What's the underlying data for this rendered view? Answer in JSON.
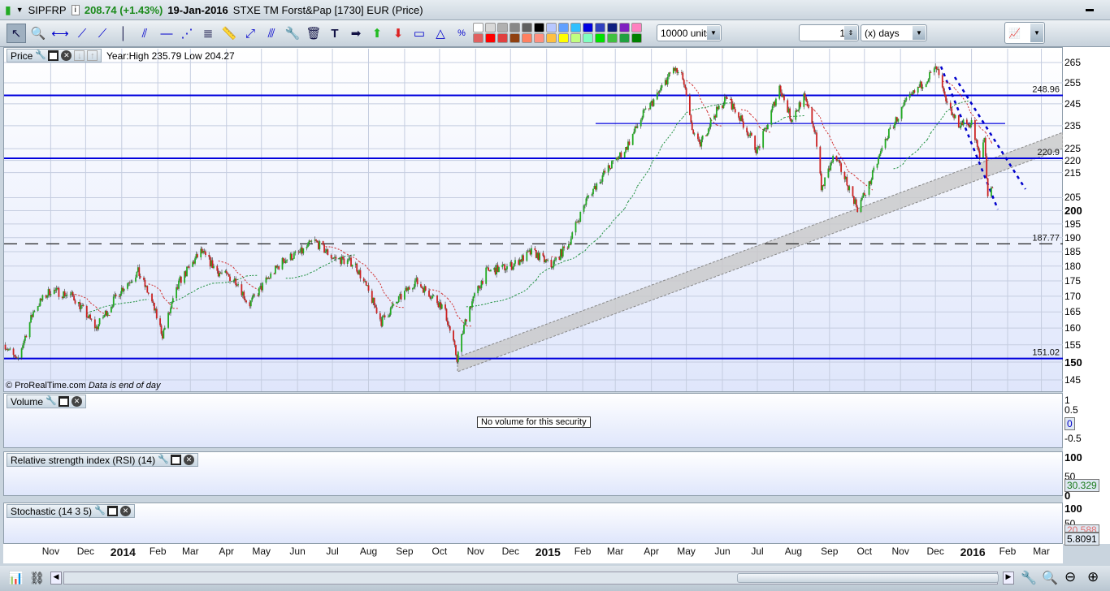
{
  "header": {
    "symbol": "SIPFRP",
    "last": "208.74 (+1.43%)",
    "date": "19-Jan-2016",
    "description": "STXE TM Forst&Pap [1730] EUR (Price)"
  },
  "toolbar": {
    "units": "10000 units",
    "period_value": "1",
    "period_unit": "(x) days",
    "colors_top": [
      "#ffffff",
      "#d8d8d8",
      "#b0b0b0",
      "#888888",
      "#606060",
      "#000000",
      "#b8c8ff",
      "#60a0ff",
      "#30c0ff",
      "#0000e0",
      "#3040c0",
      "#102080",
      "#8020c0",
      "#ff80c0"
    ],
    "colors_bottom": [
      "#e06060",
      "#ff0000",
      "#e04040",
      "#904010",
      "#ff8060",
      "#ff9080",
      "#ffc040",
      "#ffff00",
      "#c0ff80",
      "#80ffc0",
      "#00e000",
      "#40c040",
      "#20a040",
      "#008000"
    ]
  },
  "price_pane": {
    "title": "Price",
    "info": "Year:High 235.79 Low 204.27",
    "copyright": "© ProRealTime.com",
    "note": "Data is end of day",
    "current": "208.74"
  },
  "volume_pane": {
    "title": "Volume",
    "message": "No volume for this security",
    "ticks": [
      "1",
      "0.5",
      "0",
      "-0.5"
    ]
  },
  "rsi_pane": {
    "title": "Relative strength index (RSI) (14)",
    "ticks": [
      "100",
      "50",
      "0"
    ],
    "current": "30.329"
  },
  "stoch_pane": {
    "title": "Stochastic (14 3 5)",
    "ticks": [
      "100",
      "50"
    ],
    "current_d": "20.588",
    "current_k": "5.8091"
  },
  "chart_data": {
    "type": "candlestick",
    "scale": "log",
    "ylim": [
      145,
      268
    ],
    "yticks": [
      145,
      150,
      155,
      160,
      165,
      170,
      175,
      180,
      185,
      190,
      195,
      200,
      205,
      215,
      220,
      225,
      235,
      245,
      255,
      265
    ],
    "levels": [
      {
        "value": 248.96,
        "label": "248.96"
      },
      {
        "value": 220.9,
        "label": "220.9"
      },
      {
        "value": 187.77,
        "label": "187.77",
        "dashed": true
      },
      {
        "value": 151.02,
        "label": "151.02"
      },
      {
        "value": 236,
        "label": ""
      }
    ],
    "x_labels": [
      {
        "date": "2013-11-01",
        "label": "Nov"
      },
      {
        "date": "2013-12-01",
        "label": "Dec"
      },
      {
        "date": "2014-01-01",
        "label": "2014",
        "bold": true
      },
      {
        "date": "2014-02-01",
        "label": "Feb"
      },
      {
        "date": "2014-03-01",
        "label": "Mar"
      },
      {
        "date": "2014-04-01",
        "label": "Apr"
      },
      {
        "date": "2014-05-01",
        "label": "May"
      },
      {
        "date": "2014-06-01",
        "label": "Jun"
      },
      {
        "date": "2014-07-01",
        "label": "Jul"
      },
      {
        "date": "2014-08-01",
        "label": "Aug"
      },
      {
        "date": "2014-09-01",
        "label": "Sep"
      },
      {
        "date": "2014-10-01",
        "label": "Oct"
      },
      {
        "date": "2014-11-01",
        "label": "Nov"
      },
      {
        "date": "2014-12-01",
        "label": "Dec"
      },
      {
        "date": "2015-01-01",
        "label": "2015",
        "bold": true
      },
      {
        "date": "2015-02-01",
        "label": "Feb"
      },
      {
        "date": "2015-03-01",
        "label": "Mar"
      },
      {
        "date": "2015-04-01",
        "label": "Apr"
      },
      {
        "date": "2015-05-01",
        "label": "May"
      },
      {
        "date": "2015-06-01",
        "label": "Jun"
      },
      {
        "date": "2015-07-01",
        "label": "Jul"
      },
      {
        "date": "2015-08-01",
        "label": "Aug"
      },
      {
        "date": "2015-09-01",
        "label": "Sep"
      },
      {
        "date": "2015-10-01",
        "label": "Oct"
      },
      {
        "date": "2015-11-01",
        "label": "Nov"
      },
      {
        "date": "2015-12-01",
        "label": "Dec"
      },
      {
        "date": "2016-01-01",
        "label": "2016",
        "bold": true
      },
      {
        "date": "2016-02-01",
        "label": "Feb"
      },
      {
        "date": "2016-03-01",
        "label": "Mar"
      }
    ],
    "price_keypoints": [
      [
        "2013-09-23",
        155
      ],
      [
        "2013-10-03",
        150
      ],
      [
        "2013-10-18",
        166
      ],
      [
        "2013-11-01",
        172
      ],
      [
        "2013-11-20",
        170
      ],
      [
        "2013-12-10",
        160
      ],
      [
        "2013-12-31",
        172
      ],
      [
        "2014-01-15",
        178
      ],
      [
        "2014-01-25",
        170
      ],
      [
        "2014-02-05",
        158
      ],
      [
        "2014-02-20",
        175
      ],
      [
        "2014-03-10",
        185
      ],
      [
        "2014-03-25",
        178
      ],
      [
        "2014-04-10",
        175
      ],
      [
        "2014-04-20",
        167
      ],
      [
        "2014-05-05",
        175
      ],
      [
        "2014-05-20",
        182
      ],
      [
        "2014-06-05",
        185
      ],
      [
        "2014-06-15",
        189
      ],
      [
        "2014-07-01",
        183
      ],
      [
        "2014-07-20",
        181
      ],
      [
        "2014-08-05",
        168
      ],
      [
        "2014-08-12",
        162
      ],
      [
        "2014-08-25",
        168
      ],
      [
        "2014-09-10",
        175
      ],
      [
        "2014-09-25",
        170
      ],
      [
        "2014-10-05",
        166
      ],
      [
        "2014-10-16",
        151
      ],
      [
        "2014-10-25",
        165
      ],
      [
        "2014-11-10",
        178
      ],
      [
        "2014-12-01",
        180
      ],
      [
        "2014-12-20",
        185
      ],
      [
        "2015-01-05",
        180
      ],
      [
        "2015-01-20",
        188
      ],
      [
        "2015-02-05",
        205
      ],
      [
        "2015-02-20",
        215
      ],
      [
        "2015-03-10",
        225
      ],
      [
        "2015-03-25",
        240
      ],
      [
        "2015-04-05",
        248
      ],
      [
        "2015-04-20",
        262
      ],
      [
        "2015-04-28",
        257
      ],
      [
        "2015-05-05",
        235
      ],
      [
        "2015-05-12",
        226
      ],
      [
        "2015-05-25",
        240
      ],
      [
        "2015-06-05",
        248
      ],
      [
        "2015-06-20",
        235
      ],
      [
        "2015-07-01",
        224
      ],
      [
        "2015-07-10",
        236
      ],
      [
        "2015-07-20",
        253
      ],
      [
        "2015-07-30",
        238
      ],
      [
        "2015-08-10",
        248
      ],
      [
        "2015-08-20",
        232
      ],
      [
        "2015-08-25",
        208
      ],
      [
        "2015-09-05",
        222
      ],
      [
        "2015-09-15",
        212
      ],
      [
        "2015-09-25",
        201
      ],
      [
        "2015-10-05",
        210
      ],
      [
        "2015-10-20",
        230
      ],
      [
        "2015-11-05",
        245
      ],
      [
        "2015-11-25",
        258
      ],
      [
        "2015-12-02",
        262
      ],
      [
        "2015-12-10",
        245
      ],
      [
        "2015-12-20",
        236
      ],
      [
        "2016-01-01",
        236
      ],
      [
        "2016-01-08",
        221
      ],
      [
        "2016-01-12",
        230
      ],
      [
        "2016-01-15",
        206
      ],
      [
        "2016-01-19",
        208.74
      ]
    ],
    "colors": {
      "up": "#22aa22",
      "down": "#cc2222",
      "level": "#0000dd",
      "current_bg": "#f5c400"
    }
  }
}
